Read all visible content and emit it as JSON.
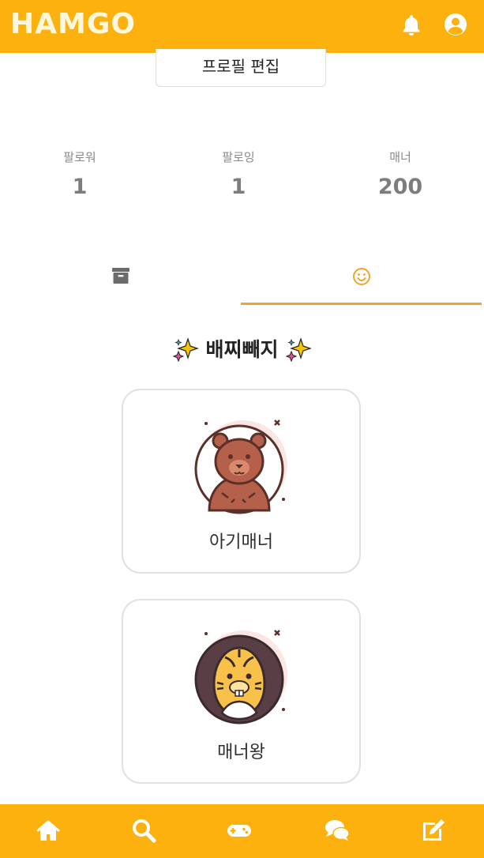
{
  "header": {
    "logo": "HAMGO",
    "icons": [
      "bell-icon",
      "user-circle-icon"
    ]
  },
  "profile": {
    "edit_button": "프로필 편집"
  },
  "stats": [
    {
      "label": "팔로워",
      "value": "1"
    },
    {
      "label": "팔로잉",
      "value": "1"
    },
    {
      "label": "매너",
      "value": "200"
    }
  ],
  "tabs": [
    {
      "icon": "archive-box-icon",
      "active": false
    },
    {
      "icon": "smile-icon",
      "active": true
    }
  ],
  "badges": {
    "title": "배찌빼지",
    "items": [
      {
        "label": "아기매너",
        "icon": "bear-badge-icon"
      },
      {
        "label": "매너왕",
        "icon": "tiger-badge-icon"
      }
    ]
  },
  "bottom_nav": [
    "home-icon",
    "search-icon",
    "gamepad-icon",
    "chat-icon",
    "edit-icon"
  ],
  "colors": {
    "accent": "#fdb10f",
    "tab_underline": "#f0a42a"
  }
}
